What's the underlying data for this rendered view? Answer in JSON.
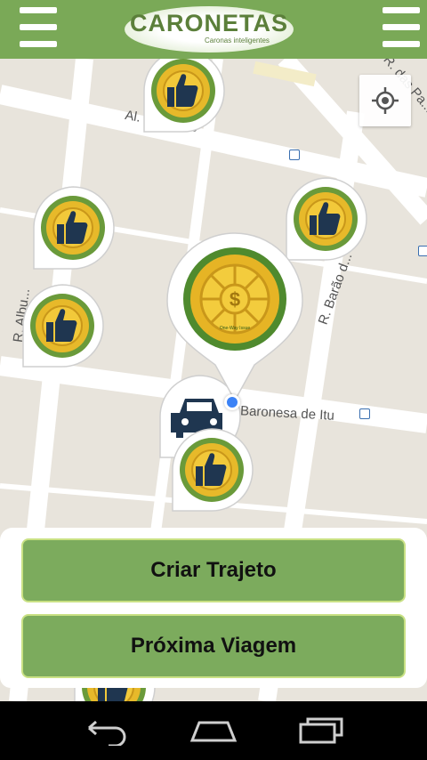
{
  "app": {
    "logo_text": "CARONETAS",
    "logo_tagline": "Caronas inteligentes"
  },
  "map": {
    "streets": [
      {
        "id": "alameda-barros",
        "label": "Al. ... Barros"
      },
      {
        "id": "r-das-palmeiras",
        "label": "R. das Pa..."
      },
      {
        "id": "r-barao",
        "label": "R. Barão d..."
      },
      {
        "id": "baronesa-itu",
        "label": "Baronesa de Itu"
      },
      {
        "id": "r-albuquerque",
        "label": "R. Albu..."
      }
    ],
    "center_marker_caption": "One-Way Issue"
  },
  "actions": {
    "create_route": "Criar Trajeto",
    "next_trip": "Próxima Viagem"
  },
  "colors": {
    "brand_green": "#7aa957",
    "button_green": "#7cab5d",
    "button_border": "#c9e184",
    "map_bg": "#e8e4dc",
    "road": "#ffffff",
    "user_location": "#3b82f6"
  },
  "icons": {
    "menu_left": "hamburger-menu-icon",
    "menu_right": "hamburger-menu-icon",
    "locate": "crosshair-locate-icon",
    "thumbs_up_marker": "thumbs-up-icon",
    "coin_marker": "dollar-coin-icon",
    "car_marker": "car-icon",
    "back": "back-icon",
    "home": "home-icon",
    "recents": "recent-apps-icon"
  }
}
